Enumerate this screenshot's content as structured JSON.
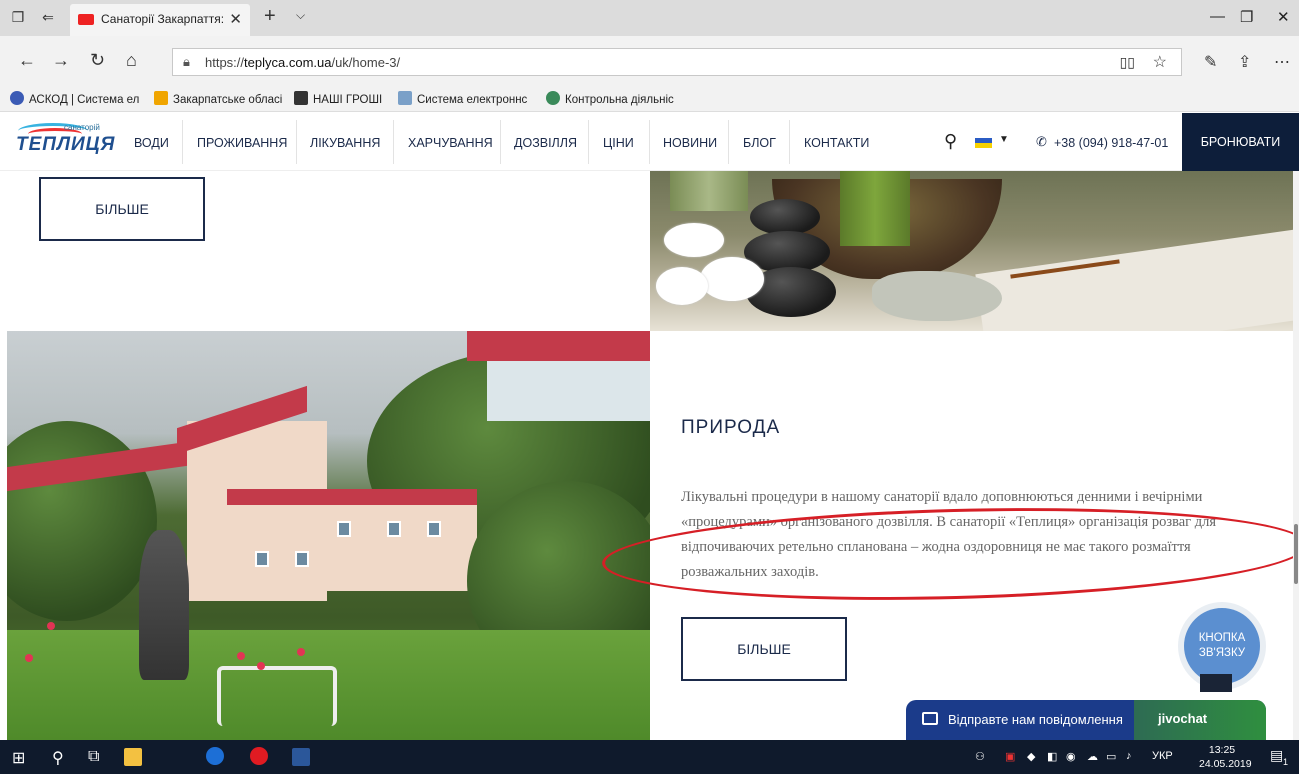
{
  "browser": {
    "tab_title": "Санаторії Закарпаття: (",
    "url_prefix": "https://",
    "url_host": "teplyca.com.ua",
    "url_path": "/uk/home-3/",
    "favorites": [
      {
        "label": "АСКОД | Система ел",
        "color": "#3b5bb5"
      },
      {
        "label": "Закарпатське обласі",
        "color": "#f0a500"
      },
      {
        "label": "НАШІ ГРОШІ",
        "color": "#333333"
      },
      {
        "label": "Система електроннс",
        "color": "#7aa0c8"
      },
      {
        "label": "Контрольна діяльніс",
        "color": "#3a8a5a"
      }
    ]
  },
  "site": {
    "logo": {
      "brand": "ТЕПЛИЦЯ",
      "sub": "санаторій"
    },
    "menu": [
      "ВОДИ",
      "ПРОЖИВАННЯ",
      "ЛІКУВАННЯ",
      "ХАРЧУВАННЯ",
      "ДОЗВІЛЛЯ",
      "ЦІНИ",
      "НОВИНИ",
      "БЛОГ",
      "КОНТАКТИ"
    ],
    "phone": "+38 (094) 918-47-01",
    "book_label": "БРОНЮВАТИ"
  },
  "content": {
    "top_more_label": "БІЛЬШЕ",
    "section_title": "ПРИРОДА",
    "section_body": "Лікувальні процедури в нашому санаторії вдало доповнюються денними і вечірніми «процедурами» організованого дозвілля. В санаторії «Теплиця» організація розваг для відпочиваючих ретельно спланована – жодна оздоровниця не має такого розмаїття розважальних заходів.",
    "section_more_label": "БІЛЬШЕ",
    "contact_bubble": "КНОПКА ЗВ'ЯЗКУ",
    "chat_label": "Відправте нам повідомлення",
    "chat_brand": "jivochat"
  },
  "taskbar": {
    "lang": "УКР",
    "time": "13:25",
    "date": "24.05.2019",
    "notifications": "1"
  },
  "colors": {
    "navy": "#0d1e3a",
    "annotation_red": "#d61f26",
    "contact_blue": "#5b8fd0"
  }
}
